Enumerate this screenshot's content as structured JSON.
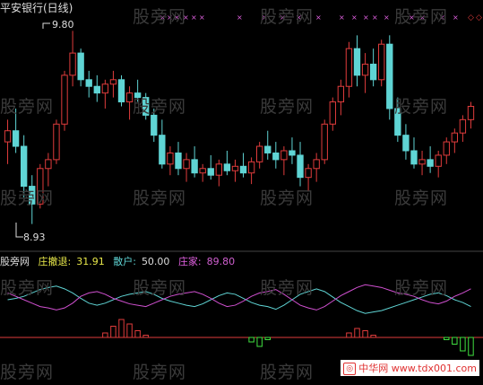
{
  "title": "平安银行(日线)",
  "high_label": "9.80",
  "low_label": "8.93",
  "watermark": "股旁网",
  "indicator": {
    "name": "股旁网",
    "zhuangchetui_label": "庄撤退:",
    "zhuangchetui_value": "31.91",
    "sanhu_label": "散户:",
    "sanhu_value": "50.00",
    "zhuangjia_label": "庄家:",
    "zhuangjia_value": "89.80"
  },
  "site": {
    "text": "中华网 www.tdx001.com"
  },
  "colors": {
    "up": "#e03c3c",
    "down": "#5fd4d4",
    "zhuangjia": "#d050d0",
    "sanhu": "#5fd4d4",
    "zero_line": "#e03c3c",
    "bar_pos": "#e03c3c",
    "bar_neg": "#40e040"
  },
  "chart_data": {
    "type": "candlestick",
    "price_high": 9.8,
    "price_low": 8.93,
    "candles": [
      [
        9.3,
        9.4,
        9.2,
        9.35
      ],
      [
        9.35,
        9.45,
        9.25,
        9.28
      ],
      [
        9.28,
        9.33,
        9.05,
        9.1
      ],
      [
        9.1,
        9.15,
        8.93,
        9.02
      ],
      [
        9.02,
        9.2,
        9.0,
        9.18
      ],
      [
        9.18,
        9.25,
        9.1,
        9.22
      ],
      [
        9.22,
        9.4,
        9.2,
        9.38
      ],
      [
        9.38,
        9.62,
        9.35,
        9.6
      ],
      [
        9.6,
        9.8,
        9.55,
        9.7
      ],
      [
        9.7,
        9.72,
        9.55,
        9.58
      ],
      [
        9.58,
        9.62,
        9.5,
        9.55
      ],
      [
        9.55,
        9.6,
        9.48,
        9.52
      ],
      [
        9.52,
        9.58,
        9.45,
        9.56
      ],
      [
        9.56,
        9.62,
        9.5,
        9.58
      ],
      [
        9.58,
        9.6,
        9.46,
        9.48
      ],
      [
        9.48,
        9.55,
        9.4,
        9.52
      ],
      [
        9.52,
        9.58,
        9.48,
        9.5
      ],
      [
        9.5,
        9.52,
        9.4,
        9.42
      ],
      [
        9.42,
        9.45,
        9.3,
        9.33
      ],
      [
        9.33,
        9.4,
        9.18,
        9.2
      ],
      [
        9.2,
        9.28,
        9.15,
        9.25
      ],
      [
        9.25,
        9.3,
        9.15,
        9.18
      ],
      [
        9.18,
        9.25,
        9.12,
        9.22
      ],
      [
        9.22,
        9.28,
        9.14,
        9.16
      ],
      [
        9.16,
        9.2,
        9.12,
        9.18
      ],
      [
        9.18,
        9.24,
        9.13,
        9.15
      ],
      [
        9.15,
        9.22,
        9.1,
        9.2
      ],
      [
        9.2,
        9.26,
        9.15,
        9.17
      ],
      [
        9.17,
        9.22,
        9.12,
        9.19
      ],
      [
        9.19,
        9.25,
        9.14,
        9.16
      ],
      [
        9.16,
        9.23,
        9.11,
        9.21
      ],
      [
        9.21,
        9.3,
        9.18,
        9.28
      ],
      [
        9.28,
        9.35,
        9.22,
        9.25
      ],
      [
        9.25,
        9.3,
        9.18,
        9.22
      ],
      [
        9.22,
        9.28,
        9.15,
        9.26
      ],
      [
        9.26,
        9.32,
        9.2,
        9.24
      ],
      [
        9.24,
        9.3,
        9.1,
        9.14
      ],
      [
        9.14,
        9.2,
        9.08,
        9.18
      ],
      [
        9.18,
        9.25,
        9.12,
        9.22
      ],
      [
        9.22,
        9.4,
        9.2,
        9.38
      ],
      [
        9.38,
        9.5,
        9.35,
        9.48
      ],
      [
        9.48,
        9.58,
        9.42,
        9.55
      ],
      [
        9.55,
        9.75,
        9.5,
        9.72
      ],
      [
        9.72,
        9.78,
        9.55,
        9.6
      ],
      [
        9.6,
        9.7,
        9.52,
        9.65
      ],
      [
        9.65,
        9.72,
        9.55,
        9.58
      ],
      [
        9.58,
        9.76,
        9.55,
        9.74
      ],
      [
        9.74,
        9.78,
        9.4,
        9.45
      ],
      [
        9.45,
        9.5,
        9.3,
        9.33
      ],
      [
        9.33,
        9.38,
        9.22,
        9.26
      ],
      [
        9.26,
        9.32,
        9.18,
        9.2
      ],
      [
        9.2,
        9.26,
        9.15,
        9.22
      ],
      [
        9.22,
        9.28,
        9.16,
        9.19
      ],
      [
        9.19,
        9.26,
        9.14,
        9.24
      ],
      [
        9.24,
        9.32,
        9.2,
        9.3
      ],
      [
        9.3,
        9.36,
        9.25,
        9.34
      ],
      [
        9.34,
        9.42,
        9.3,
        9.4
      ],
      [
        9.4,
        9.48,
        9.36,
        9.46
      ]
    ],
    "indicator_series": {
      "zhuangjia": [
        60,
        55,
        50,
        45,
        40,
        38,
        35,
        38,
        45,
        55,
        60,
        62,
        58,
        52,
        48,
        44,
        42,
        40,
        45,
        50,
        55,
        58,
        60,
        62,
        58,
        52,
        45,
        40,
        42,
        48,
        55,
        60,
        62,
        65,
        58,
        50,
        42,
        38,
        35,
        40,
        48,
        56,
        62,
        68,
        72,
        70,
        68,
        64,
        60,
        58,
        55,
        50,
        46,
        44,
        48,
        55,
        60,
        66
      ],
      "sanhu": [
        50,
        52,
        55,
        60,
        65,
        68,
        70,
        66,
        60,
        52,
        45,
        42,
        45,
        50,
        55,
        58,
        60,
        62,
        58,
        52,
        48,
        45,
        42,
        40,
        44,
        50,
        56,
        60,
        58,
        52,
        46,
        42,
        40,
        36,
        42,
        50,
        58,
        62,
        66,
        62,
        54,
        46,
        40,
        34,
        30,
        32,
        34,
        38,
        42,
        46,
        50,
        54,
        58,
        60,
        56,
        50,
        46,
        40
      ],
      "bars": [
        0,
        0,
        0,
        0,
        0,
        0,
        0,
        0,
        0,
        0,
        0,
        0,
        2,
        5,
        8,
        6,
        3,
        1,
        0,
        0,
        0,
        0,
        0,
        0,
        0,
        0,
        0,
        0,
        0,
        0,
        -2,
        -4,
        -1,
        0,
        0,
        0,
        0,
        0,
        0,
        0,
        0,
        0,
        2,
        4,
        3,
        1,
        0,
        0,
        0,
        0,
        0,
        0,
        0,
        0,
        -1,
        -3,
        -6,
        -8
      ]
    }
  }
}
